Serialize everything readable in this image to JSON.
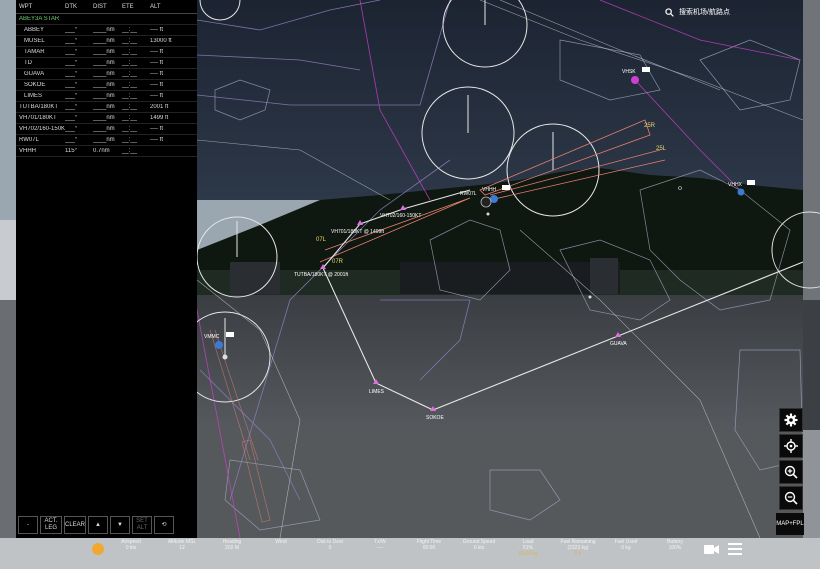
{
  "fpl": {
    "headers": {
      "wpt": "WPT",
      "dtk": "DTK",
      "dist": "DIST",
      "ete": "ETE",
      "alt": "ALT"
    },
    "procedure": "ABEY3A STAR",
    "rows": [
      {
        "wpt": "ABBEY",
        "dtk": "___°",
        "dist": "____nm",
        "ete": "__:__",
        "alt": "---- ft",
        "sub": true
      },
      {
        "wpt": "MUSEL",
        "dtk": "___°",
        "dist": "____nm",
        "ete": "__:__",
        "alt": "13000 ft",
        "sub": true
      },
      {
        "wpt": "TAMAR",
        "dtk": "___°",
        "dist": "____nm",
        "ete": "__:__",
        "alt": "---- ft",
        "sub": true
      },
      {
        "wpt": "TD",
        "dtk": "___°",
        "dist": "____nm",
        "ete": "__:__",
        "alt": "---- ft",
        "sub": true
      },
      {
        "wpt": "GUAVA",
        "dtk": "___°",
        "dist": "____nm",
        "ete": "__:__",
        "alt": "---- ft",
        "sub": true
      },
      {
        "wpt": "SOKOE",
        "dtk": "___°",
        "dist": "____nm",
        "ete": "__:__",
        "alt": "---- ft",
        "sub": true
      },
      {
        "wpt": "LIMES",
        "dtk": "___°",
        "dist": "____nm",
        "ete": "__:__",
        "alt": "---- ft",
        "sub": true
      },
      {
        "wpt": "TUTBA/180KT",
        "dtk": "___°",
        "dist": "____nm",
        "ete": "__:__",
        "alt": "2001 ft",
        "sub": false
      },
      {
        "wpt": "VH701/180KT",
        "dtk": "___°",
        "dist": "____nm",
        "ete": "__:__",
        "alt": "1499 ft",
        "sub": false
      },
      {
        "wpt": "VH702/160-150KT",
        "dtk": "___°",
        "dist": "____nm",
        "ete": "__:__",
        "alt": "---- ft",
        "sub": false
      },
      {
        "wpt": "RW07L",
        "dtk": "___°",
        "dist": "____nm",
        "ete": "__:__",
        "alt": "---- ft",
        "sub": false
      },
      {
        "wpt": "VHHH",
        "dtk": "115°",
        "dist": "0.7nm",
        "ete": "__:__",
        "alt": "",
        "sub": false
      }
    ],
    "buttons": {
      "dash": "-",
      "act_leg": "ACT.\nLEG",
      "clear": "CLEAR",
      "up": "▲",
      "down": "▼",
      "set_alt": "SET\nALT",
      "link": "⟲"
    }
  },
  "search": {
    "placeholder": "搜索机场/航路点"
  },
  "map": {
    "airports": [
      "VHSK",
      "VHHX",
      "VHHH",
      "VMMC"
    ],
    "waypoints": [
      "VH701/180KT @ 1499ft",
      "VH702/160-150KT",
      "TUTBA/180KT @ 2001ft",
      "LIMES",
      "SOKOE",
      "GUAVA"
    ],
    "runways": [
      "25R",
      "25L",
      "07L",
      "07R",
      "RW07L"
    ],
    "colors": {
      "route": "#e6e6e6",
      "waypoint": "#e070e0",
      "runway": "#e8d86a",
      "airspace": "#8a7ab8",
      "aircraft": "#3a7bd5",
      "magenta": "#d040d0"
    }
  },
  "controls": {
    "map_fpl": "MAP+FPL"
  },
  "bottombar": [
    {
      "label": "Airspeed",
      "value": "0 kts"
    },
    {
      "label": "Altitude MSL",
      "value": "12"
    },
    {
      "label": "Heading",
      "value": "202 M"
    },
    {
      "label": "Wind",
      "value": ""
    },
    {
      "label": "Dist to Dest",
      "value": "0"
    },
    {
      "label": "Tx/W",
      "value": "----"
    },
    {
      "label": "Flight Time",
      "value": "00:00"
    },
    {
      "label": "Ground Speed",
      "value": "0 kts"
    },
    {
      "label": "Load",
      "value": "51%",
      "value2": "15.64 kg"
    },
    {
      "label": "Fuel Remaining",
      "value": "(2323 kg)",
      "value2": "0 h"
    },
    {
      "label": "Fuel Used",
      "value": "0 kg"
    },
    {
      "label": "Battery",
      "value": "100%"
    }
  ]
}
